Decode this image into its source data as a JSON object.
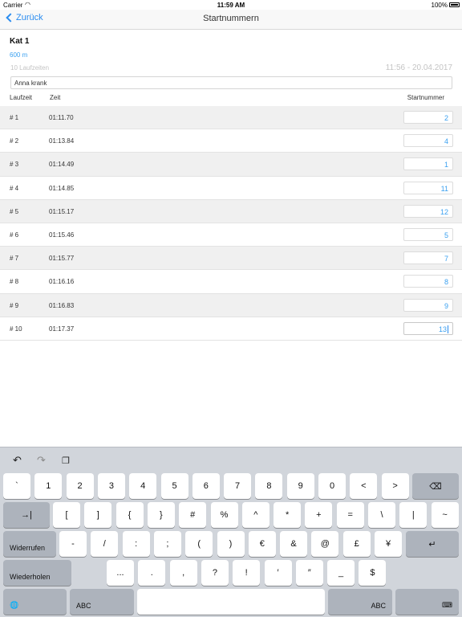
{
  "status": {
    "carrier": "Carrier",
    "wifi_icon": "wifi-icon",
    "time": "11:59 AM",
    "battery": "100%"
  },
  "nav": {
    "back_label": "Zurück",
    "title": "Startnummern"
  },
  "header": {
    "category": "Kat 1",
    "distance": "600 m",
    "count": "10 Laufzeiten",
    "datetime": "11:56 - 20.04.2017",
    "note": "Anna krank"
  },
  "columns": {
    "laufzeit": "Laufzeit",
    "zeit": "Zeit",
    "startnummer": "Startnummer"
  },
  "rows": [
    {
      "lauf": "# 1",
      "zeit": "01:11.70",
      "start": "2"
    },
    {
      "lauf": "# 2",
      "zeit": "01:13.84",
      "start": "4"
    },
    {
      "lauf": "# 3",
      "zeit": "01:14.49",
      "start": "1"
    },
    {
      "lauf": "# 4",
      "zeit": "01:14.85",
      "start": "11"
    },
    {
      "lauf": "# 5",
      "zeit": "01:15.17",
      "start": "12"
    },
    {
      "lauf": "# 6",
      "zeit": "01:15.46",
      "start": "5"
    },
    {
      "lauf": "# 7",
      "zeit": "01:15.77",
      "start": "7"
    },
    {
      "lauf": "# 8",
      "zeit": "01:16.16",
      "start": "8"
    },
    {
      "lauf": "# 9",
      "zeit": "01:16.83",
      "start": "9"
    },
    {
      "lauf": "# 10",
      "zeit": "01:17.37",
      "start": "13"
    }
  ],
  "keyboard": {
    "shortcuts": {
      "undo": "↶",
      "redo": "↷",
      "paste": "❐"
    },
    "row1": [
      "`",
      "1",
      "2",
      "3",
      "4",
      "5",
      "6",
      "7",
      "8",
      "9",
      "0",
      "<",
      ">"
    ],
    "row2": [
      "[",
      "]",
      "{",
      "}",
      "#",
      "%",
      "^",
      "*",
      "+",
      "=",
      "\\",
      "|",
      "~"
    ],
    "row3": [
      "-",
      "/",
      ":",
      ";",
      "(",
      ")",
      "€",
      "&",
      "@",
      "£",
      "¥"
    ],
    "row4": [
      "...",
      ".",
      ",",
      "?",
      "!",
      "′",
      "″",
      "_",
      "$"
    ],
    "delete": "⌫",
    "tab": "→|",
    "undo_key": "Widerrufen",
    "return": "↵",
    "redo_key": "Wiederholen",
    "globe": "🌐",
    "abc_left": "ABC",
    "abc_right": "ABC",
    "hide": "⌨"
  }
}
